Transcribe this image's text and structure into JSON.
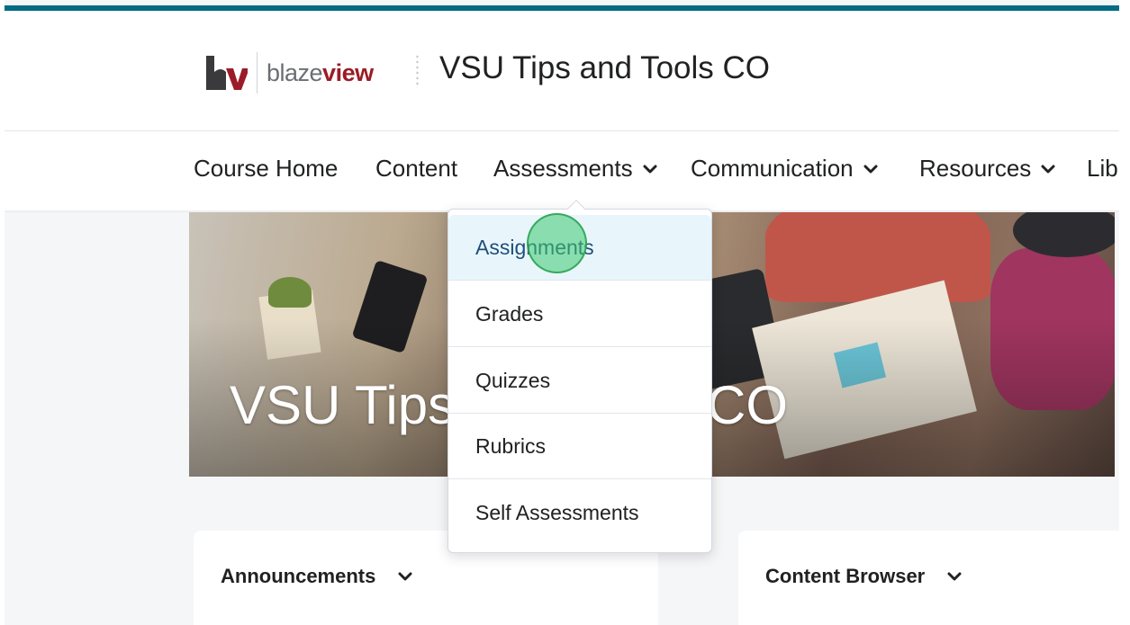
{
  "header": {
    "logo_text_light": "blaze",
    "logo_text_bold": "view",
    "course_title": "VSU Tips and Tools CO"
  },
  "nav": {
    "items": [
      {
        "label": "Course Home",
        "has_menu": false
      },
      {
        "label": "Content",
        "has_menu": false
      },
      {
        "label": "Assessments",
        "has_menu": true
      },
      {
        "label": "Communication",
        "has_menu": true
      },
      {
        "label": "Resources",
        "has_menu": true
      },
      {
        "label": "Lib",
        "has_menu": false
      }
    ]
  },
  "hero": {
    "title_start": "VSU Tips",
    "title_end": "CO"
  },
  "assessments_menu": {
    "items": [
      {
        "label": "Assignments",
        "highlighted": true
      },
      {
        "label": "Grades",
        "highlighted": false
      },
      {
        "label": "Quizzes",
        "highlighted": false
      },
      {
        "label": "Rubrics",
        "highlighted": false
      },
      {
        "label": "Self Assessments",
        "highlighted": false
      }
    ]
  },
  "widgets": {
    "announcements_title": "Announcements",
    "content_browser_title": "Content Browser"
  },
  "colors": {
    "top_accent": "#006b84",
    "logo_red": "#9b1c26",
    "menu_highlight_bg": "#e8f6fc",
    "menu_highlight_text": "#1f4e79",
    "click_marker": "#3cc86e"
  },
  "icons": {
    "chevron": "chevron-down-icon",
    "logo": "blazeview-logo-icon"
  }
}
